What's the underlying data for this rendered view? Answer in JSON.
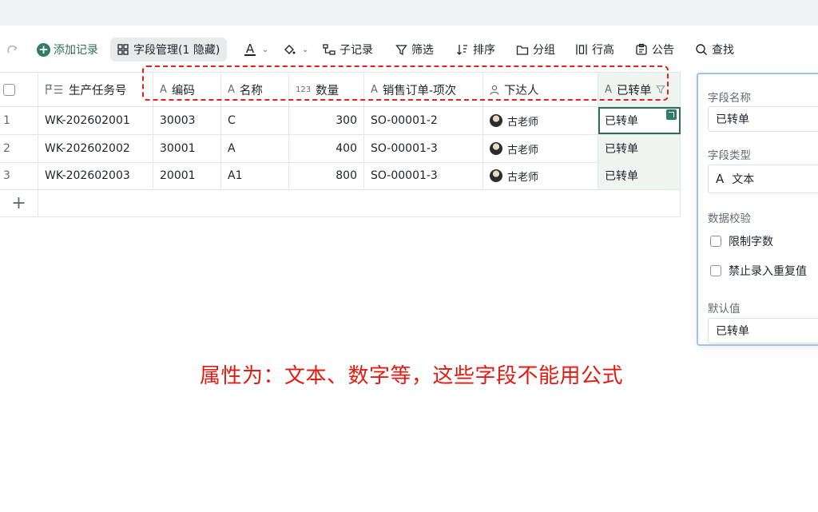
{
  "toolbar": {
    "add_record": "添加记录",
    "field_manage": "字段管理(1 隐藏)",
    "font_letter": "A",
    "sub_record": "子记录",
    "filter": "筛选",
    "sort": "排序",
    "group": "分组",
    "row_height": "行高",
    "notice": "公告",
    "search": "查找"
  },
  "table": {
    "headers": [
      "生产任务号",
      "编码",
      "名称",
      "数量",
      "销售订单-项次",
      "下达人",
      "已转单"
    ],
    "header_icons": [
      "flag-list-icon",
      "text-icon",
      "text-icon",
      "number-icon",
      "text-icon",
      "person-icon",
      "text-icon"
    ],
    "number_icon_text": "123",
    "rows": [
      {
        "index": "1",
        "task": "WK-202602001",
        "code": "30003",
        "name": "C",
        "qty": "300",
        "order": "SO-00001-2",
        "person": "古老师",
        "converted": "已转单"
      },
      {
        "index": "2",
        "task": "WK-202602002",
        "code": "30001",
        "name": "A",
        "qty": "400",
        "order": "SO-00001-3",
        "person": "古老师",
        "converted": "已转单"
      },
      {
        "index": "3",
        "task": "WK-202602003",
        "code": "20001",
        "name": "A1",
        "qty": "800",
        "order": "SO-00001-3",
        "person": "古老师",
        "converted": "已转单"
      }
    ]
  },
  "panel": {
    "field_name_label": "字段名称",
    "field_name_value": "已转单",
    "field_type_label": "字段类型",
    "field_type_value": "文本",
    "validation_label": "数据校验",
    "limit_chars": "限制字数",
    "no_duplicates": "禁止录入重复值",
    "default_label": "默认值",
    "default_value": "已转单"
  },
  "annotation": "属性为：文本、数字等，这些字段不能用公式",
  "colors": {
    "accent": "#2f7d64",
    "annotation": "#e01b12",
    "converted_bg": "#eef5f1",
    "panel_border": "#9cc2f0"
  }
}
